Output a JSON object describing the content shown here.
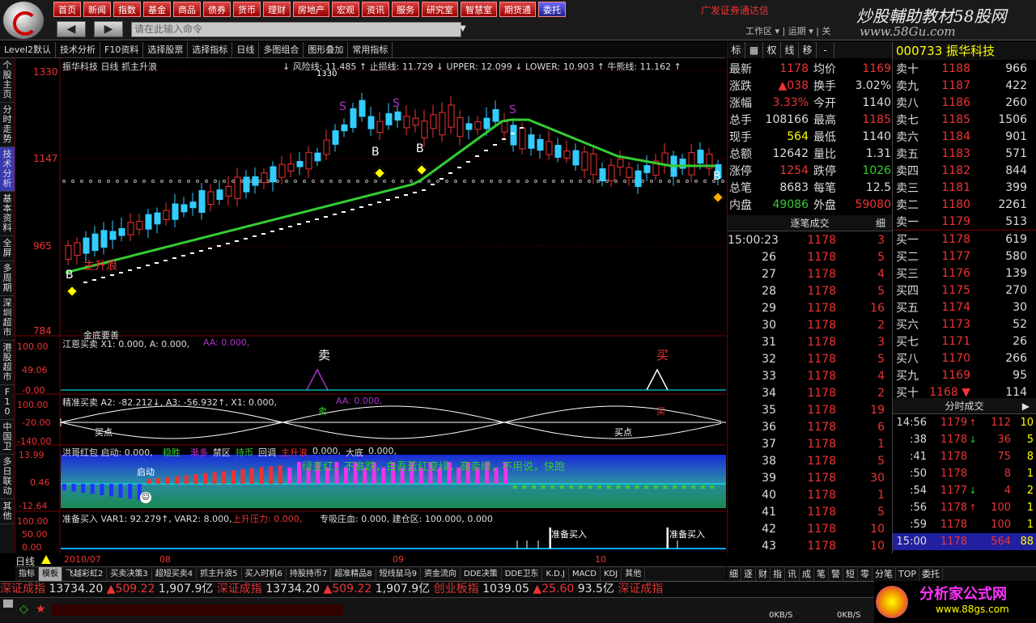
{
  "menu": [
    "首页",
    "新闻",
    "指数",
    "基金",
    "商品",
    "债券",
    "货币",
    "理财",
    "房地产",
    "宏观",
    "资讯",
    "服务",
    "研究室",
    "智慧室",
    "期货通",
    "委托"
  ],
  "brand": "广发证券通达信",
  "watermark": {
    "line1": "炒股輔助教材58股网",
    "line2": "www.58Gu.com"
  },
  "command": {
    "placeholder": "请在此输入命令",
    "back": "◀",
    "forward": "▶"
  },
  "zone_label": "工作区 ▾  |  运期 ▾  |  关",
  "toolbar": [
    "Level2默认",
    "技术分析",
    "F10资料",
    "选择股票",
    "选择指标",
    "日线",
    "多图组合",
    "图形叠加",
    "常用指标"
  ],
  "left_tabs": [
    "个股主页",
    "分时走势",
    "技术分析",
    "基本资料",
    "全屏",
    "多周期",
    "深圳超市",
    "港股超市",
    "F10",
    "中国卫",
    "多日联动",
    "其他"
  ],
  "price_panel": {
    "title": "振华科技 日线 抓主升浪",
    "indicators": "↓ 风险线: 11.485 ↑  止损线: 11.729 ↓  UPPER: 12.099 ↓  LOWER: 10.903 ↑  牛熊线: 11.162 ↑",
    "y_labels": [
      "1330",
      "1147",
      "965",
      "784"
    ],
    "label_1330": "1330",
    "annotation": "主升浪",
    "bottom_label": "金底要善"
  },
  "panel2": {
    "title": "江恩买卖 X1: 0.000, A: 0.000,",
    "extra": "AA: 0.000,",
    "y_labels": [
      "100.00",
      "49.06",
      "-0.00"
    ],
    "sell": "卖",
    "buy": "买"
  },
  "panel3": {
    "title": "精准买卖 A2: -82.212↓, A3: -56.932↑, X1: 0.000,",
    "extra": "AA: 0.000,",
    "y_labels": [
      "100.00",
      "-20.00",
      "-140.00"
    ],
    "buy_point": "买点",
    "sell_mark": "卖",
    "buy_mark": "买"
  },
  "panel4": {
    "title": "洪哥红包 启动: 0.000,",
    "items": [
      "稳胜",
      "",
      "渐多",
      "禁区",
      "持币",
      "回调",
      "主升浪",
      "0.000,",
      "大底",
      "0.000,"
    ],
    "y_labels": [
      "13.99",
      "0.46",
      "-12.64"
    ],
    "start": "启动",
    "caption": "绿变红，不准跌，白吾蓝红变绿，高卖绿，不用说，快跑"
  },
  "panel5": {
    "title": "准备买入 VAR1: 92.279↑, VAR2: 8.000,",
    "extra": "上升压力: 0.000,",
    "extra2": "专吸庄血: 0.000, 建仓区: 100.000, 0.000",
    "y_labels": [
      "100.00",
      "50.00",
      "0.00"
    ],
    "prep_buy": "准备买入"
  },
  "x_axis": {
    "left": "日线",
    "labels": [
      "2010/07",
      "08",
      "09",
      "10"
    ]
  },
  "bottom_tabs": [
    "指标",
    "模板",
    "飞越彩虹2",
    "买卖决策3",
    "超短买卖4",
    "抓主升浪5",
    "买入时机6",
    "持股持币7",
    "超准精品8",
    "短线鼠马9",
    "资金流向",
    "DDE决策",
    "DDE卫东",
    "K.D.J",
    "MACD",
    "KDJ",
    "其他"
  ],
  "quote": {
    "tabs": [
      "标",
      "▦",
      "权",
      "线",
      "移",
      "-"
    ],
    "rows": [
      {
        "l": "最新",
        "v": "1178",
        "l2": "均价",
        "v2": "1169",
        "c": "red",
        "c2": "red"
      },
      {
        "l": "涨跌",
        "v": "▲038",
        "l2": "换手",
        "v2": "3.02%",
        "c": "red",
        "c2": "white"
      },
      {
        "l": "涨幅",
        "v": "3.33%",
        "l2": "今开",
        "v2": "1140",
        "c": "red",
        "c2": "white"
      },
      {
        "l": "总手",
        "v": "108166",
        "l2": "最高",
        "v2": "1185",
        "c": "white",
        "c2": "red"
      },
      {
        "l": "现手",
        "v": "564",
        "l2": "最低",
        "v2": "1140",
        "c": "yellow",
        "c2": "white"
      },
      {
        "l": "总额",
        "v": "12642",
        "l2": "量比",
        "v2": "1.31",
        "c": "white",
        "c2": "white"
      },
      {
        "l": "涨停",
        "v": "1254",
        "l2": "跌停",
        "v2": "1026",
        "c": "red",
        "c2": "green"
      },
      {
        "l": "总笔",
        "v": "8683",
        "l2": "每笔",
        "v2": "12.5",
        "c": "white",
        "c2": "white"
      },
      {
        "l": "内盘",
        "v": "49086",
        "l2": "外盘",
        "v2": "59080",
        "c": "green",
        "c2": "red"
      }
    ]
  },
  "stock": {
    "code": "000733",
    "name": "振华科技"
  },
  "book": {
    "sells": [
      {
        "l": "卖十",
        "p": "1188",
        "v": "966"
      },
      {
        "l": "卖九",
        "p": "1187",
        "v": "422"
      },
      {
        "l": "卖八",
        "p": "1186",
        "v": "260"
      },
      {
        "l": "卖七",
        "p": "1185",
        "v": "1506"
      },
      {
        "l": "卖六",
        "p": "1184",
        "v": "901"
      },
      {
        "l": "卖五",
        "p": "1183",
        "v": "571"
      },
      {
        "l": "卖四",
        "p": "1182",
        "v": "844"
      },
      {
        "l": "卖三",
        "p": "1181",
        "v": "399"
      },
      {
        "l": "卖二",
        "p": "1180",
        "v": "2261"
      },
      {
        "l": "卖一",
        "p": "1179",
        "v": "513"
      }
    ],
    "buys": [
      {
        "l": "买一",
        "p": "1178",
        "v": "619"
      },
      {
        "l": "买二",
        "p": "1177",
        "v": "580"
      },
      {
        "l": "买三",
        "p": "1176",
        "v": "139"
      },
      {
        "l": "买四",
        "p": "1175",
        "v": "270"
      },
      {
        "l": "买五",
        "p": "1174",
        "v": "30"
      },
      {
        "l": "买六",
        "p": "1173",
        "v": "52"
      },
      {
        "l": "买七",
        "p": "1171",
        "v": "26"
      },
      {
        "l": "买八",
        "p": "1170",
        "v": "266"
      },
      {
        "l": "买九",
        "p": "1169",
        "v": "95"
      },
      {
        "l": "买十",
        "p": "1168 ▼",
        "v": "114"
      }
    ]
  },
  "ticks": {
    "title": "逐笔成交",
    "detail": "细",
    "rows": [
      {
        "t": "15:00:23",
        "p": "1178",
        "v": "3"
      },
      {
        "t": "26",
        "p": "1178",
        "v": "5"
      },
      {
        "t": "27",
        "p": "1178",
        "v": "4"
      },
      {
        "t": "28",
        "p": "1178",
        "v": "5"
      },
      {
        "t": "29",
        "p": "1178",
        "v": "16"
      },
      {
        "t": "30",
        "p": "1178",
        "v": "2"
      },
      {
        "t": "31",
        "p": "1178",
        "v": "3"
      },
      {
        "t": "32",
        "p": "1178",
        "v": "5"
      },
      {
        "t": "33",
        "p": "1178",
        "v": "4"
      },
      {
        "t": "34",
        "p": "1178",
        "v": "2"
      },
      {
        "t": "35",
        "p": "1178",
        "v": "19"
      },
      {
        "t": "36",
        "p": "1178",
        "v": "6"
      },
      {
        "t": "37",
        "p": "1178",
        "v": "1"
      },
      {
        "t": "38",
        "p": "1178",
        "v": "5"
      },
      {
        "t": "39",
        "p": "1178",
        "v": "30"
      },
      {
        "t": "40",
        "p": "1178",
        "v": "1"
      },
      {
        "t": "41",
        "p": "1178",
        "v": "5"
      },
      {
        "t": "42",
        "p": "1178",
        "v": "10"
      },
      {
        "t": "43",
        "p": "1178",
        "v": "10"
      }
    ]
  },
  "minute": {
    "title": "分时成交",
    "rows": [
      {
        "t": "14:56",
        "p": "1179",
        "i": "↑",
        "v": "112",
        "n": "10"
      },
      {
        "t": ":38",
        "p": "1178",
        "i": "↓",
        "v": "36",
        "n": "5"
      },
      {
        "t": ":41",
        "p": "1178",
        "i": "",
        "v": "75",
        "n": "8"
      },
      {
        "t": ":50",
        "p": "1178",
        "i": "",
        "v": "8",
        "n": "1"
      },
      {
        "t": ":54",
        "p": "1177",
        "i": "↓",
        "v": "4",
        "n": "2"
      },
      {
        "t": ":56",
        "p": "1178",
        "i": "↑",
        "v": "100",
        "n": "1"
      },
      {
        "t": ":59",
        "p": "1178",
        "i": "",
        "v": "100",
        "n": "1"
      },
      {
        "t": "15:00",
        "p": "1178",
        "i": "",
        "v": "564",
        "n": "88"
      }
    ]
  },
  "right_tabs": [
    "细",
    "逐",
    "财",
    "指",
    "讯",
    "成",
    "笔",
    "警",
    "短",
    "零",
    "分笔",
    "TOP",
    "委托"
  ],
  "ticker": [
    {
      "text": "深证成指",
      "c": "#d33"
    },
    {
      "text": "13734.20",
      "c": "#ddd"
    },
    {
      "text": "▲509.22",
      "c": "#e33"
    },
    {
      "text": "1,907.9亿",
      "c": "#ddd"
    },
    {
      "text": "深证成指",
      "c": "#d33"
    },
    {
      "text": "13734.20",
      "c": "#ddd"
    },
    {
      "text": "▲509.22",
      "c": "#e33"
    },
    {
      "text": "1,907.9亿",
      "c": "#ddd"
    },
    {
      "text": "创业板指",
      "c": "#d33"
    },
    {
      "text": "1039.05",
      "c": "#ddd"
    },
    {
      "text": "▲25.60",
      "c": "#e33"
    },
    {
      "text": "93.5亿",
      "c": "#ddd"
    },
    {
      "text": "深证成指",
      "c": "#d33"
    }
  ],
  "status": {
    "speed1": "0KB/S",
    "speed2": "0KB/S",
    "ad_title": "分析家公式网",
    "ad_url": "www.88gs.com"
  }
}
